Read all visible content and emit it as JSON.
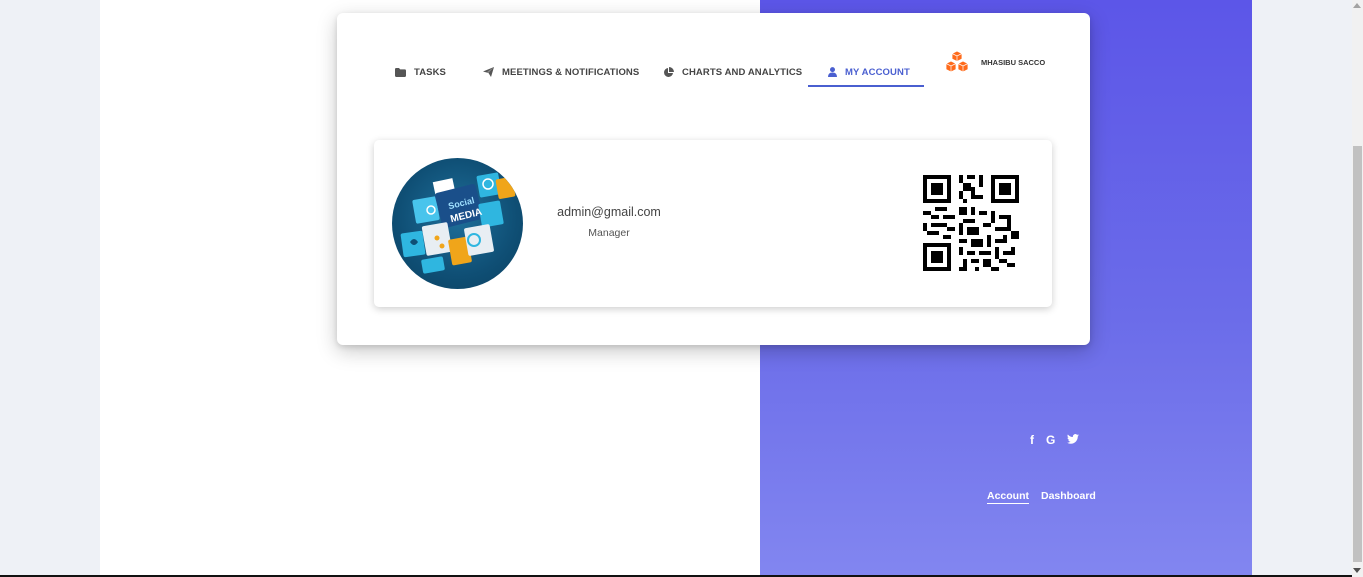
{
  "tabs": [
    {
      "label": "TASKS",
      "icon": "folder-icon"
    },
    {
      "label": "MEETINGS & NOTIFICATIONS",
      "icon": "paper-plane-icon"
    },
    {
      "label": "CHARTS AND ANALYTICS",
      "icon": "pie-chart-icon"
    },
    {
      "label": "MY ACCOUNT",
      "icon": "user-icon",
      "active": true
    }
  ],
  "brand": {
    "name": "MHASIBU SACCO",
    "icon": "cubes-logo-icon"
  },
  "profile": {
    "email": "admin@gmail.com",
    "role": "Manager",
    "avatar_text": [
      "Social",
      "MEDIA"
    ]
  },
  "social": [
    {
      "label": "f",
      "icon": "facebook-icon"
    },
    {
      "label": "G",
      "icon": "google-icon"
    },
    {
      "label": "♥",
      "icon": "twitter-icon"
    }
  ],
  "footer": {
    "links": [
      "Account",
      "Dashboard"
    ],
    "active": "Account"
  },
  "colors": {
    "accent": "#4a5fd0",
    "gradient_top": "#5c56e8",
    "gradient_bottom": "#8286f0",
    "brand_orange": "#ff6a1a"
  }
}
